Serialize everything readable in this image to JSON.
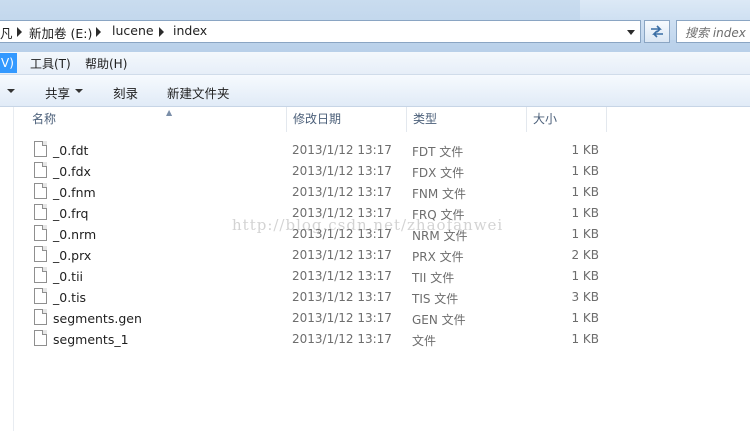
{
  "address_bar": {
    "crumbs": [
      "凡",
      "新加卷 (E:)",
      "lucene",
      "index"
    ]
  },
  "search": {
    "placeholder": "搜索 index"
  },
  "menu": {
    "items": [
      {
        "label": "V)",
        "active": true
      },
      {
        "label": "工具(T)"
      },
      {
        "label": "帮助(H)"
      }
    ]
  },
  "toolbar": {
    "share_label": "共享",
    "burn_label": "刻录",
    "new_folder_label": "新建文件夹"
  },
  "columns": {
    "name": "名称",
    "modified": "修改日期",
    "type": "类型",
    "size": "大小"
  },
  "files": [
    {
      "name": "_0.fdt",
      "modified": "2013/1/12 13:17",
      "type": "FDT 文件",
      "size": "1 KB"
    },
    {
      "name": "_0.fdx",
      "modified": "2013/1/12 13:17",
      "type": "FDX 文件",
      "size": "1 KB"
    },
    {
      "name": "_0.fnm",
      "modified": "2013/1/12 13:17",
      "type": "FNM 文件",
      "size": "1 KB"
    },
    {
      "name": "_0.frq",
      "modified": "2013/1/12 13:17",
      "type": "FRQ 文件",
      "size": "1 KB"
    },
    {
      "name": "_0.nrm",
      "modified": "2013/1/12 13:17",
      "type": "NRM 文件",
      "size": "1 KB"
    },
    {
      "name": "_0.prx",
      "modified": "2013/1/12 13:17",
      "type": "PRX 文件",
      "size": "2 KB"
    },
    {
      "name": "_0.tii",
      "modified": "2013/1/12 13:17",
      "type": "TII 文件",
      "size": "1 KB"
    },
    {
      "name": "_0.tis",
      "modified": "2013/1/12 13:17",
      "type": "TIS 文件",
      "size": "3 KB"
    },
    {
      "name": "segments.gen",
      "modified": "2013/1/12 13:17",
      "type": "GEN 文件",
      "size": "1 KB"
    },
    {
      "name": "segments_1",
      "modified": "2013/1/12 13:17",
      "type": "文件",
      "size": "1 KB"
    }
  ],
  "watermark": "http://blog.csdn.net/zhaofanwei",
  "colors": {
    "menu_active": "#3399ff",
    "header_text": "#4c607a"
  }
}
